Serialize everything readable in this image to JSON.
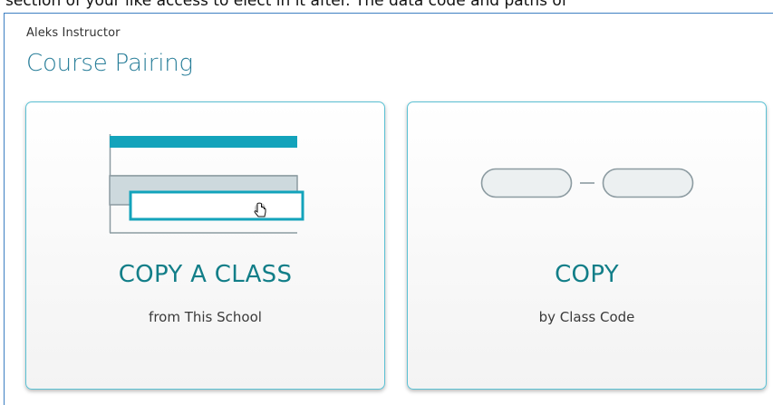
{
  "window": {
    "cut_text": "section of your like access to elect in it after. The data code and paths of"
  },
  "header": {
    "eyebrow": "Aleks Instructor",
    "title": "Course Pairing"
  },
  "cards": [
    {
      "title": "COPY A CLASS",
      "subtitle": "from This School",
      "icon": "class-list-icon"
    },
    {
      "title": "COPY",
      "subtitle": "by Class Code",
      "icon": "class-code-icon"
    }
  ],
  "colors": {
    "accent": "#13a3bb",
    "title_teal": "#127e88",
    "card_border": "#5bc1d4",
    "frame_border": "#3d7fc2"
  }
}
